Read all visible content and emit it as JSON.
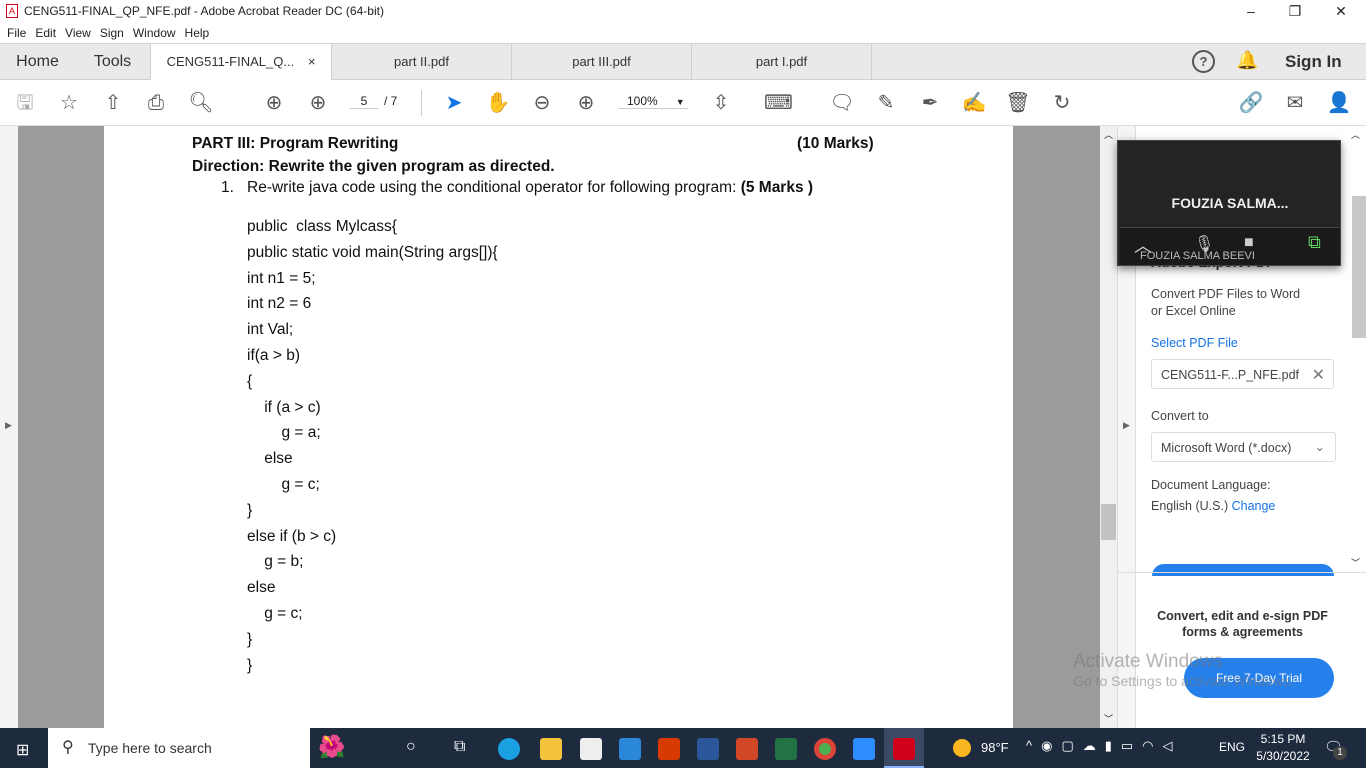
{
  "window": {
    "title": "CENG511-FINAL_QP_NFE.pdf - Adobe Acrobat Reader DC (64-bit)",
    "minimize": "–",
    "restore": "❐",
    "close": "✕"
  },
  "menu": [
    "File",
    "Edit",
    "View",
    "Sign",
    "Window",
    "Help"
  ],
  "tabs": {
    "home": "Home",
    "tools": "Tools",
    "items": [
      {
        "label": "CENG511-FINAL_Q...",
        "close": "×"
      },
      {
        "label": "part II.pdf"
      },
      {
        "label": "part III.pdf"
      },
      {
        "label": "part I.pdf"
      }
    ],
    "sign_in": "Sign In"
  },
  "toolbar": {
    "page_current": "5",
    "page_total": "/ 7",
    "zoom": "100%"
  },
  "document": {
    "heading": "PART III: Program Rewriting",
    "marks": "(10 Marks)",
    "direction": "Direction: Rewrite the given program as directed.",
    "q_num": "1.",
    "question": "Re-write java code using the conditional operator for following program: ",
    "q_marks": "(5 Marks )",
    "code": [
      "public  class Mylcass{",
      "public static void main(String args[]){",
      "int n1 = 5;",
      "int n2 = 6",
      "int Val;",
      "if(a > b)",
      "{",
      "    if (a > c)",
      "        g = a;",
      "    else",
      "        g = c;",
      "}",
      "else if (b > c)",
      "    g = b;",
      "else",
      "    g = c;",
      "}",
      "}"
    ]
  },
  "meeting": {
    "name": "FOUZIA  SALMA...",
    "participant": "FOUZIA SALMA BEEVI"
  },
  "export_panel": {
    "title": "Adobe Export PDF",
    "desc1": "Convert PDF Files to Word",
    "desc2": "or Excel Online",
    "select_label": "Select PDF File",
    "file": "CENG511-F...P_NFE.pdf",
    "convert_label": "Convert to",
    "convert_value": "Microsoft Word (*.docx)",
    "lang_label": "Document Language:",
    "lang_value": "English (U.S.)",
    "change": "Change",
    "promo1": "Convert, edit and e-sign PDF",
    "promo2": "forms & agreements",
    "trial": "Free 7-Day Trial"
  },
  "watermark": {
    "line1": "Activate Windows",
    "line2": "Go to Settings to activate Windows."
  },
  "taskbar": {
    "search": "Type here to search",
    "weather": "98°F",
    "lang": "ENG",
    "time": "5:15 PM",
    "date": "5/30/2022",
    "notif": "1"
  },
  "colors": {
    "accent": "#2680eb",
    "taskbar": "#1e2a3e",
    "acrobat_red": "#d0021b"
  }
}
